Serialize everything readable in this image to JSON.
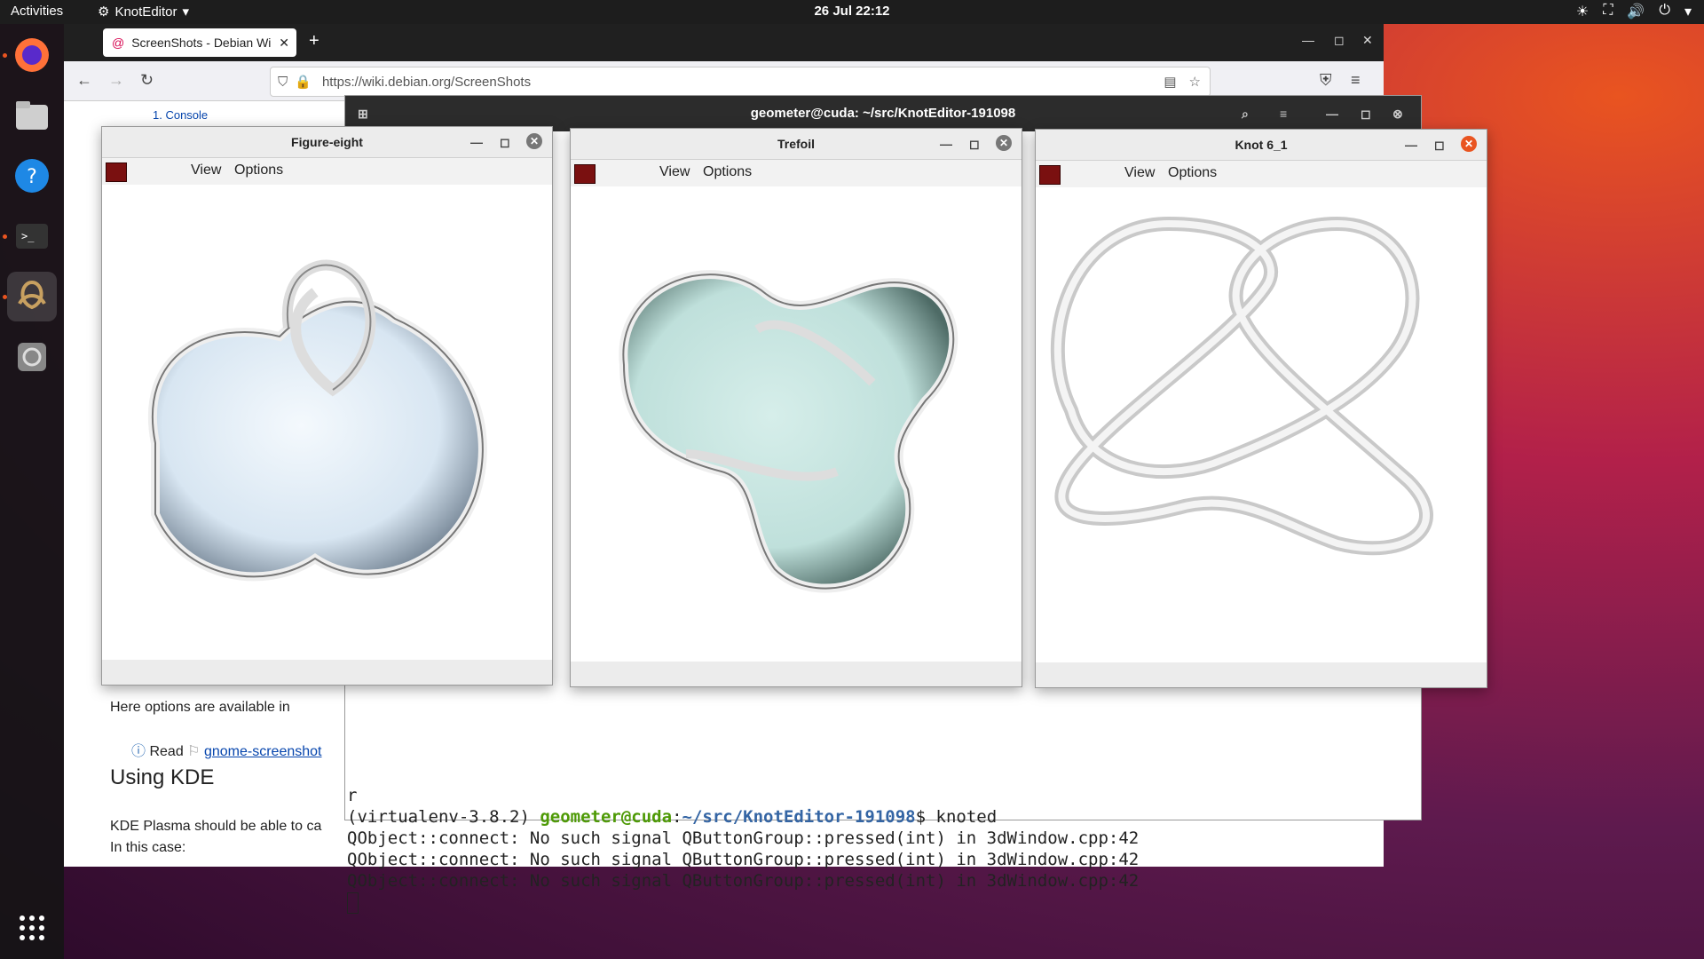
{
  "topbar": {
    "activities": "Activities",
    "app": "KnotEditor",
    "clock": "26 Jul  22:12"
  },
  "dock": {
    "items": [
      "firefox-icon",
      "files-icon",
      "help-icon",
      "terminal-icon",
      "knoteditor-icon",
      "disc-icon"
    ],
    "apps_grid": "show-apps-icon"
  },
  "browser": {
    "tab_title": "ScreenShots - Debian Wi",
    "url": "https://wiki.debian.org/ScreenShots",
    "toc_item": "1.  Console",
    "partial_text": "Here options are available in",
    "info_read": "Read",
    "info_link": "gnome-screenshot",
    "heading": "Using KDE",
    "kde_text": "KDE Plasma should be able to ca",
    "kde_text2": "In this case:"
  },
  "terminal": {
    "title": "geometer@cuda: ~/src/KnotEditor-191098",
    "side_chars": "r",
    "prompt_env": "(virtualenv-3.8.2) ",
    "prompt_user": "geometer@cuda",
    "prompt_colon": ":",
    "prompt_path": "~/src/KnotEditor-191098",
    "prompt_cmd": "$ knoted",
    "lines": [
      "QObject::connect: No such signal QButtonGroup::pressed(int) in 3dWindow.cpp:42",
      "QObject::connect: No such signal QButtonGroup::pressed(int) in 3dWindow.cpp:42",
      "QObject::connect: No such signal QButtonGroup::pressed(int) in 3dWindow.cpp:42"
    ]
  },
  "windows": [
    {
      "title": "Figure-eight",
      "menu": [
        "View",
        "Options"
      ]
    },
    {
      "title": "Trefoil",
      "menu": [
        "View",
        "Options"
      ]
    },
    {
      "title": "Knot 6_1",
      "menu": [
        "View",
        "Options"
      ]
    }
  ],
  "colors": {
    "ubuntu_orange": "#e95420",
    "surface_eight": "#d8e6f2",
    "surface_trefoil": "#bfe0db"
  }
}
